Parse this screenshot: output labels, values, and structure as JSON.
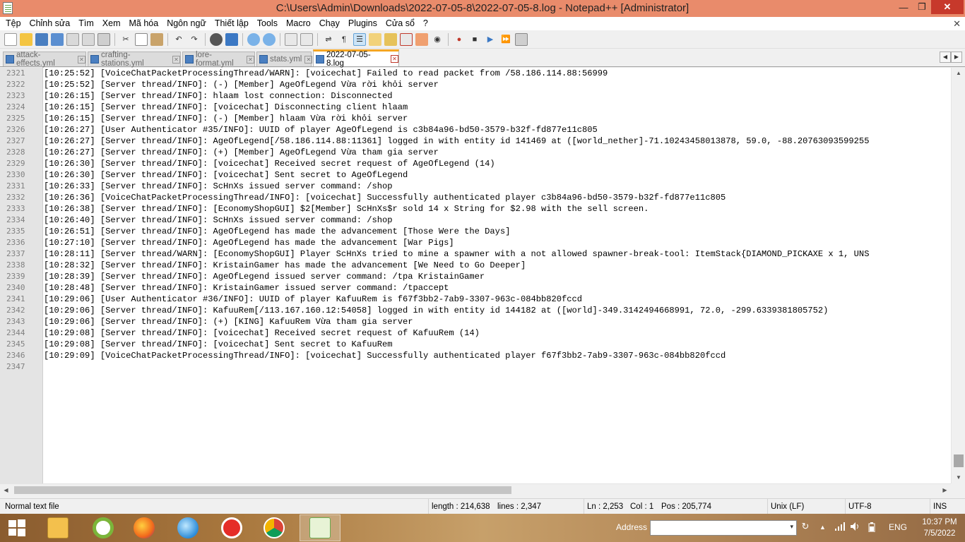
{
  "window": {
    "title": "C:\\Users\\Admin\\Downloads\\2022-07-05-8\\2022-07-05-8.log - Notepad++ [Administrator]",
    "minimize": "—",
    "maximize": "❐",
    "close": "✕"
  },
  "menu": {
    "items": [
      "Tệp",
      "Chỉnh sửa",
      "Tìm",
      "Xem",
      "Mã hóa",
      "Ngôn ngữ",
      "Thiết lập",
      "Tools",
      "Macro",
      "Chạy",
      "Plugins",
      "Cửa sổ",
      "?"
    ],
    "close_glyph": "✕"
  },
  "tabs": [
    {
      "label": "attack-effects.yml",
      "active": false
    },
    {
      "label": "crafting-stations.yml",
      "active": false
    },
    {
      "label": "lore-format.yml",
      "active": false
    },
    {
      "label": "stats.yml",
      "active": false
    },
    {
      "label": "2022-07-05-8.log",
      "active": true
    }
  ],
  "tab_close_glyph": "✕",
  "tab_scroll": {
    "left": "◀",
    "right": "▶"
  },
  "editor": {
    "lines": [
      {
        "n": "2321",
        "text": "[10:25:52] [VoiceChatPacketProcessingThread/WARN]: [voicechat] Failed to read packet from /58.186.114.88:56999"
      },
      {
        "n": "2322",
        "text": "[10:25:52] [Server thread/INFO]: (-) [Member] AgeOfLegend Vừa rời khỏi server"
      },
      {
        "n": "2323",
        "text": "[10:26:15] [Server thread/INFO]: hlaam lost connection: Disconnected"
      },
      {
        "n": "2324",
        "text": "[10:26:15] [Server thread/INFO]: [voicechat] Disconnecting client hlaam"
      },
      {
        "n": "2325",
        "text": "[10:26:15] [Server thread/INFO]: (-) [Member] hlaam Vừa rời khỏi server"
      },
      {
        "n": "2326",
        "text": "[10:26:27] [User Authenticator #35/INFO]: UUID of player AgeOfLegend is c3b84a96-bd50-3579-b32f-fd877e11c805"
      },
      {
        "n": "2327",
        "text": "[10:26:27] [Server thread/INFO]: AgeOfLegend[/58.186.114.88:11361] logged in with entity id 141469 at ([world_nether]-71.10243458013878, 59.0, -88.20763093599255"
      },
      {
        "n": "2328",
        "text": "[10:26:27] [Server thread/INFO]: (+) [Member] AgeOfLegend Vừa tham gia server"
      },
      {
        "n": "2329",
        "text": "[10:26:30] [Server thread/INFO]: [voicechat] Received secret request of AgeOfLegend (14)"
      },
      {
        "n": "2330",
        "text": "[10:26:30] [Server thread/INFO]: [voicechat] Sent secret to AgeOfLegend"
      },
      {
        "n": "2331",
        "text": "[10:26:33] [Server thread/INFO]: ScHnXs issued server command: /shop"
      },
      {
        "n": "2332",
        "text": "[10:26:36] [VoiceChatPacketProcessingThread/INFO]: [voicechat] Successfully authenticated player c3b84a96-bd50-3579-b32f-fd877e11c805"
      },
      {
        "n": "2333",
        "text": "[10:26:38] [Server thread/INFO]: [EconomyShopGUI] $2[Member] ScHnXs$r sold 14 x String for $2.98 with the sell screen."
      },
      {
        "n": "2334",
        "text": "[10:26:40] [Server thread/INFO]: ScHnXs issued server command: /shop"
      },
      {
        "n": "2335",
        "text": "[10:26:51] [Server thread/INFO]: AgeOfLegend has made the advancement [Those Were the Days]"
      },
      {
        "n": "2336",
        "text": "[10:27:10] [Server thread/INFO]: AgeOfLegend has made the advancement [War Pigs]"
      },
      {
        "n": "2337",
        "text": "[10:28:11] [Server thread/WARN]: [EconomyShopGUI] Player ScHnXs tried to mine a spawner with a not allowed spawner-break-tool: ItemStack{DIAMOND_PICKAXE x 1, UNS"
      },
      {
        "n": "2338",
        "text": "[10:28:32] [Server thread/INFO]: KristainGamer has made the advancement [We Need to Go Deeper]"
      },
      {
        "n": "2339",
        "text": "[10:28:39] [Server thread/INFO]: AgeOfLegend issued server command: /tpa KristainGamer"
      },
      {
        "n": "2340",
        "text": "[10:28:48] [Server thread/INFO]: KristainGamer issued server command: /tpaccept"
      },
      {
        "n": "2341",
        "text": "[10:29:06] [User Authenticator #36/INFO]: UUID of player KafuuRem is f67f3bb2-7ab9-3307-963c-084bb820fccd"
      },
      {
        "n": "2342",
        "text": "[10:29:06] [Server thread/INFO]: KafuuRem[/113.167.160.12:54058] logged in with entity id 144182 at ([world]-349.3142494668991, 72.0, -299.6339381805752)"
      },
      {
        "n": "2343",
        "text": "[10:29:06] [Server thread/INFO]: (+) [KING] KafuuRem Vừa tham gia server"
      },
      {
        "n": "2344",
        "text": "[10:29:08] [Server thread/INFO]: [voicechat] Received secret request of KafuuRem (14)"
      },
      {
        "n": "2345",
        "text": "[10:29:08] [Server thread/INFO]: [voicechat] Sent secret to KafuuRem"
      },
      {
        "n": "2346",
        "text": "[10:29:09] [VoiceChatPacketProcessingThread/INFO]: [voicechat] Successfully authenticated player f67f3bb2-7ab9-3307-963c-084bb820fccd"
      },
      {
        "n": "2347",
        "text": ""
      }
    ]
  },
  "scroll": {
    "up": "▲",
    "down": "▼",
    "left": "◀",
    "right": "▶"
  },
  "status": {
    "filetype": "Normal text file",
    "length": "length : 214,638",
    "lines": "lines : 2,347",
    "ln": "Ln : 2,253",
    "col": "Col : 1",
    "pos": "Pos : 205,774",
    "eol": "Unix (LF)",
    "encoding": "UTF-8",
    "mode": "INS"
  },
  "taskbar": {
    "address_label": "Address",
    "address_value": "",
    "dropdown_glyph": "▾",
    "refresh_glyph": "↻",
    "language": "ENG",
    "time": "10:37 PM",
    "date": "7/5/2022",
    "tray_up": "▲"
  },
  "colors": {
    "title_bar": "#e98b6b",
    "close_button": "#c7392b",
    "active_tab_accent": "#f5a623"
  }
}
